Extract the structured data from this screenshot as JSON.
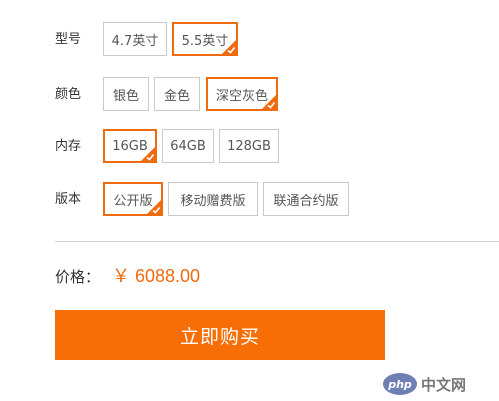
{
  "options": {
    "model": {
      "label": "型号",
      "items": [
        {
          "text": "4.7英寸",
          "selected": false
        },
        {
          "text": "5.5英寸",
          "selected": true
        }
      ]
    },
    "color": {
      "label": "颜色",
      "items": [
        {
          "text": "银色",
          "selected": false
        },
        {
          "text": "金色",
          "selected": false
        },
        {
          "text": "深空灰色",
          "selected": true
        }
      ]
    },
    "storage": {
      "label": "内存",
      "items": [
        {
          "text": "16GB",
          "selected": true
        },
        {
          "text": "64GB",
          "selected": false
        },
        {
          "text": "128GB",
          "selected": false
        }
      ]
    },
    "version": {
      "label": "版本",
      "items": [
        {
          "text": "公开版",
          "selected": true
        },
        {
          "text": "移动赠费版",
          "selected": false
        },
        {
          "text": "联通合约版",
          "selected": false
        }
      ]
    }
  },
  "price": {
    "label": "价格：",
    "value": "￥ 6088.00"
  },
  "buy_button": {
    "label": "立即购买"
  },
  "watermark": {
    "logo": "php",
    "text": "中文网"
  },
  "colors": {
    "accent": "#ee6b10",
    "button": "#f76d06",
    "price": "#f06a0e"
  }
}
